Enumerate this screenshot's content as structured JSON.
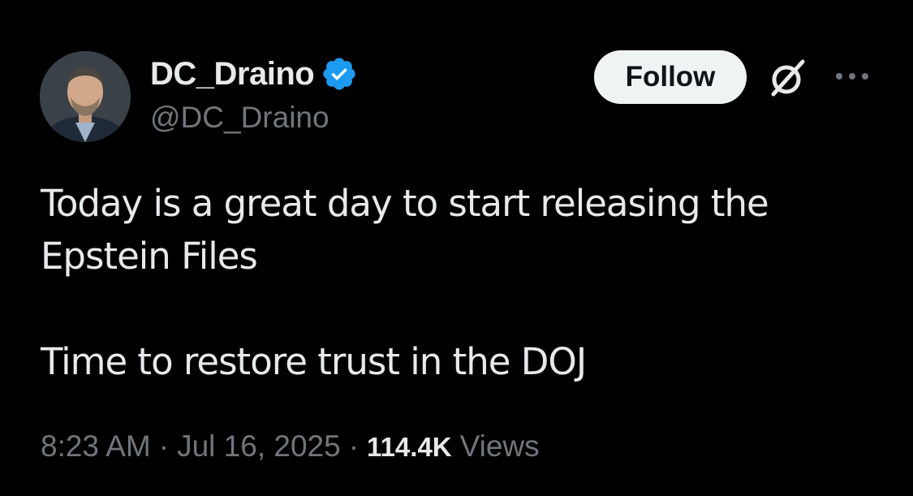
{
  "author": {
    "display_name": "DC_Draino",
    "handle": "@DC_Draino",
    "verified": true
  },
  "actions": {
    "follow_label": "Follow",
    "grok_icon": "grok-icon",
    "more_icon": "more-options-icon"
  },
  "tweet": {
    "paragraph_1": "Today is a great day to start releasing the\nEpstein Files",
    "paragraph_2": "Time to restore trust in the DOJ"
  },
  "meta": {
    "time": "8:23 AM",
    "separator": "·",
    "date": "Jul 16, 2025",
    "views_count": "114.4K",
    "views_label": "Views"
  },
  "colors": {
    "background": "#000000",
    "text": "#e7e9ea",
    "secondary": "#71767b",
    "verified_blue": "#1d9bf0",
    "follow_bg": "#eff3f4"
  }
}
